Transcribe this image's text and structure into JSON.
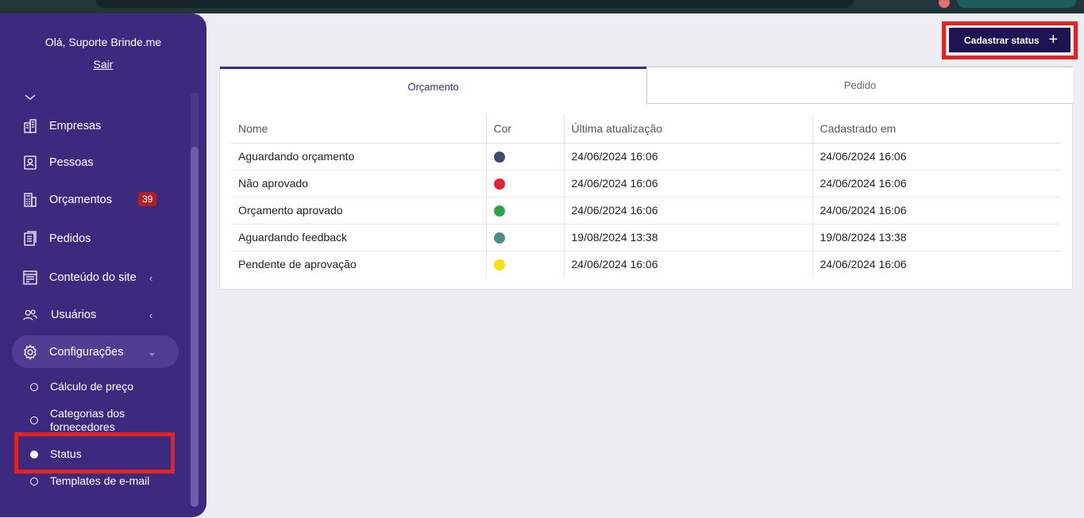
{
  "user": {
    "greeting": "Olá, Suporte Brinde.me",
    "logout": "Sair"
  },
  "nav": {
    "items": [
      {
        "label": "Empresas",
        "icon": "building-icon"
      },
      {
        "label": "Pessoas",
        "icon": "person-card-icon"
      },
      {
        "label": "Orçamentos",
        "icon": "calculator-icon",
        "badge": "39"
      },
      {
        "label": "Pedidos",
        "icon": "document-icon"
      },
      {
        "label": "Conteúdo do site",
        "icon": "layout-icon"
      },
      {
        "label": "Usuários",
        "icon": "users-icon"
      },
      {
        "label": "Configurações",
        "icon": "gear-icon"
      }
    ],
    "sub_items": [
      {
        "label": "Cálculo de preço"
      },
      {
        "label": "Categorias dos fornecedores"
      },
      {
        "label": "Status"
      },
      {
        "label": "Templates de e-mail"
      }
    ]
  },
  "toolbar": {
    "add_label": "Cadastrar status"
  },
  "tabs": [
    {
      "label": "Orçamento"
    },
    {
      "label": "Pedido"
    }
  ],
  "table": {
    "headers": [
      "Nome",
      "Cor",
      "Última atualização",
      "Cadastrado em"
    ],
    "rows": [
      {
        "name": "Aguardando orçamento",
        "color": "#3b4e72",
        "updated": "24/06/2024 16:06",
        "created": "24/06/2024 16:06"
      },
      {
        "name": "Não aprovado",
        "color": "#dd2533",
        "updated": "24/06/2024 16:06",
        "created": "24/06/2024 16:06"
      },
      {
        "name": "Orçamento aprovado",
        "color": "#2ea54a",
        "updated": "24/06/2024 16:06",
        "created": "24/06/2024 16:06"
      },
      {
        "name": "Aguardando feedback",
        "color": "#4a8b8e",
        "updated": "19/08/2024 13:38",
        "created": "19/08/2024 13:38"
      },
      {
        "name": "Pendente de aprovação",
        "color": "#f5de0a",
        "updated": "24/06/2024 16:06",
        "created": "24/06/2024 16:06"
      }
    ]
  },
  "colors": {
    "sidebar": "#3c2a7f",
    "button": "#1f1452",
    "highlight": "#e02424"
  }
}
